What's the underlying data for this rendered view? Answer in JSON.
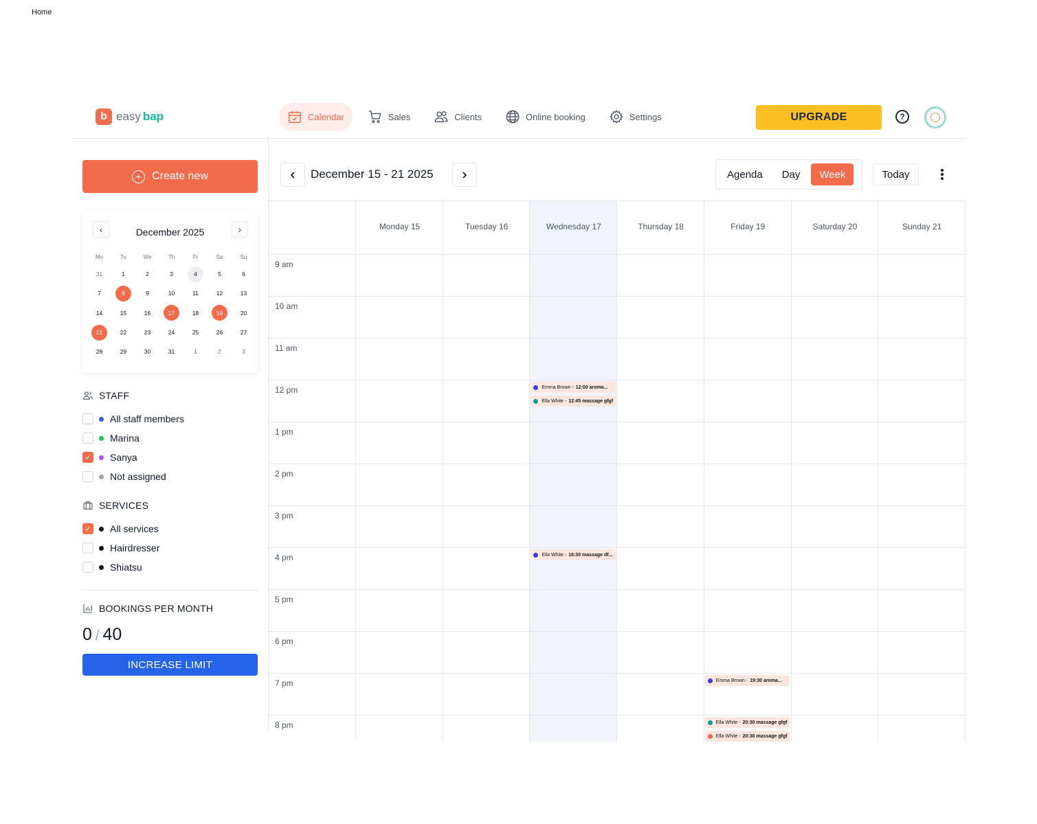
{
  "page_label": "Home",
  "brand": {
    "mark": "b",
    "name_a": "easy",
    "name_b": "bap"
  },
  "nav": [
    {
      "label": "Calendar",
      "icon": "calendar-icon",
      "active": true
    },
    {
      "label": "Sales",
      "icon": "cart-icon",
      "active": false
    },
    {
      "label": "Clients",
      "icon": "users-icon",
      "active": false
    },
    {
      "label": "Online booking",
      "icon": "globe-icon",
      "active": false
    },
    {
      "label": "Settings",
      "icon": "gear-icon",
      "active": false
    }
  ],
  "header": {
    "upgrade_label": "UPGRADE",
    "help_glyph": "?"
  },
  "sidebar": {
    "create_label": "Create new",
    "mini_calendar": {
      "title": "December 2025",
      "prev_glyph": "‹",
      "next_glyph": "›",
      "weekdays": [
        "Mo",
        "Tu",
        "We",
        "Th",
        "Fr",
        "Sa",
        "Su"
      ],
      "weeks": [
        [
          "31",
          "1",
          "2",
          "3",
          "4",
          "5",
          "6"
        ],
        [
          "7",
          "8",
          "9",
          "10",
          "11",
          "12",
          "13"
        ],
        [
          "14",
          "15",
          "16",
          "17",
          "18",
          "19",
          "20"
        ],
        [
          "21",
          "22",
          "23",
          "24",
          "25",
          "26",
          "27"
        ],
        [
          "28",
          "29",
          "30",
          "31",
          "1",
          "2",
          "3"
        ]
      ],
      "selected_days": [
        "8",
        "17",
        "19",
        "21"
      ],
      "today": "4"
    },
    "staff": {
      "title": "STAFF",
      "items": [
        {
          "label": "All staff members",
          "color": "#3b5bdb",
          "checked": false
        },
        {
          "label": "Marina",
          "color": "#22c55e",
          "checked": false
        },
        {
          "label": "Sanya",
          "color": "#a855f7",
          "checked": true
        },
        {
          "label": "Not assigned",
          "color": "#9ca3af",
          "checked": false
        }
      ]
    },
    "services": {
      "title": "SERVICES",
      "items": [
        {
          "label": "All services",
          "color": "#111111",
          "checked": true
        },
        {
          "label": "Hairdresser",
          "color": "#111111",
          "checked": false
        },
        {
          "label": "Shiatsu",
          "color": "#111111",
          "checked": false
        }
      ]
    },
    "bookings": {
      "title": "BOOKINGS PER MONTH",
      "used": "0",
      "separator": "/",
      "limit": "40"
    },
    "increase_label": "INCREASE LIMIT"
  },
  "calendar": {
    "range_title": "December 15 - 21 2025",
    "views": [
      "Agenda",
      "Day",
      "Week"
    ],
    "active_view": "Week",
    "today_label": "Today",
    "days": [
      "Monday 15",
      "Tuesday 16",
      "Wednesday 17",
      "Thursday 18",
      "Friday 19",
      "Saturday 20",
      "Sunday 21"
    ],
    "highlight_day": "Wednesday 17",
    "hours": [
      "9 am",
      "10 am",
      "11 am",
      "12 pm",
      "1 pm",
      "2 pm",
      "3 pm",
      "4 pm",
      "5 pm",
      "6 pm",
      "7 pm",
      "8 pm"
    ],
    "events": [
      {
        "day": "Wednesday 17",
        "name": "Emma Brown",
        "sep": "-",
        "detail": "12:00 aroma...",
        "color": "#3b3bd8"
      },
      {
        "day": "Wednesday 17",
        "name": "Ella White",
        "sep": "-",
        "detail": "12:45 massage gfgf",
        "color": "#0f9b8e"
      },
      {
        "day": "Friday 19",
        "name": "Emma Brown",
        "sep": "-",
        "detail": "19:30 aroma...",
        "color": "#3b3bd8"
      },
      {
        "day": "Friday 19",
        "name": "Ella White",
        "sep": "-",
        "detail": "20:30 massage gfgf",
        "color": "#0f9b8e"
      },
      {
        "day": "Friday 19",
        "name": "Ella White",
        "sep": "-",
        "detail": "20:30 massage gfgf",
        "color": "#f26b4a"
      },
      {
        "day": "Wednesday 17",
        "name": "Ella White",
        "sep": "-",
        "detail": "16:30 massage df...",
        "color": "#3b3bd8"
      }
    ]
  }
}
